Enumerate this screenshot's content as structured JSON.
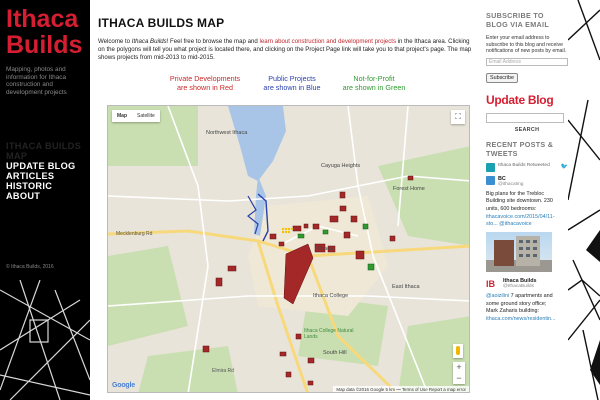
{
  "site": {
    "brand": "Ithaca Builds",
    "tagline": "Mapping, photos and information for Ithaca construction and development projects",
    "nav": [
      "Ithaca Builds Map",
      "Update Blog",
      "Articles",
      "Historic",
      "About"
    ],
    "copyright": "© Ithaca Builds, 2016"
  },
  "page": {
    "title": "ITHACA BUILDS MAP",
    "intro_a": "Welcome to ",
    "intro_em": "Ithaca Builds",
    "intro_b": "!  Feel free to browse the map and ",
    "intro_link": "learn about construction and development projects",
    "intro_c": " in the Ithaca area. Clicking on the polygons will tell you what project is located there, and clicking on the Project Page link will take you to that project's page. The map shows projects from mid-2013 to mid-2015."
  },
  "legend": {
    "red_1": "Private Developments",
    "red_2": "are shown in Red",
    "blue_1": "Public Projects",
    "blue_2": "are shown in Blue",
    "green_1": "Not-for-Profit",
    "green_2": "are shown in Green"
  },
  "map": {
    "type_map": "Map",
    "type_satellite": "Satellite",
    "labels": {
      "northwest_ithaca": "Northwest Ithaca",
      "cayuga_heights": "Cayuga Heights",
      "forest_home": "Forest Home",
      "mecklenburg_rd": "Mecklenburg Rd",
      "ithaca": "Ithaca",
      "east_ithaca": "East Ithaca",
      "ithaca_college": "Ithaca College",
      "ithaca_college_natural_lands": "Ithaca College Natural Lands",
      "south_hill": "South Hill",
      "elmira_rd": "Elmira Rd"
    },
    "google": "Google",
    "attribution": "Map data ©2016 Google    5 km ⎯⎯   Terms of Use   Report a map error"
  },
  "sidebar": {
    "subscribe_title": "SUBSCRIBE TO BLOG VIA EMAIL",
    "subscribe_text": "Enter your email address to subscribe to this blog and receive notifications of new posts by email.",
    "email_placeholder": "Email Address",
    "subscribe_button": "Subscribe",
    "update_blog_logo": "Update Blog",
    "search_button": "SEARCH",
    "recent_title": "RECENT POSTS & TWEETS",
    "retweet_label": "Ithaca Builds Retweeted",
    "tweet1_name": "BC",
    "tweet1_handle": "@ithacating",
    "tweet1_text": "Big plans for the Trebloc Building site downtown. 230 units, 600 bedrooms:",
    "tweet1_link": "ithacavoice.com/2015/04/11-sto... @ithacavoice",
    "tweet2_name": "Ithaca Builds",
    "tweet2_handle": "@IthacaBuilds",
    "tweet2_mention": "@aoizilini",
    "tweet2_text": " 7 apartments and some ground story office; Mark Zaharis building:",
    "tweet2_link": "ithaca.com/news/residentin..."
  },
  "colors": {
    "brand_red": "#d61e32",
    "private_red": "#c92a2a",
    "public_blue": "#2a3faa",
    "nonprofit_green": "#2f9a30"
  }
}
